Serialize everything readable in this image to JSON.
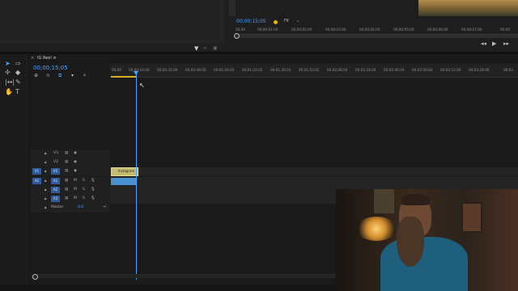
{
  "program": {
    "timecode": "00;00;15;05",
    "fit": "Fit",
    "ruler_ticks": [
      "00;00",
      "00;00;01;00",
      "00;00;02;00",
      "00;00;03;00",
      "00;00;04;00",
      "00;00;05;00",
      "00;00;06;00",
      "00;00;07;00",
      "00;00"
    ],
    "controls": [
      "step-back-icon",
      "play-icon",
      "step-forward-icon"
    ]
  },
  "tools": [
    "selection-tool",
    "track-select-tool",
    "ripple-edit-tool",
    "razor-tool",
    "slip-tool",
    "pen-tool",
    "hand-tool",
    "type-tool"
  ],
  "timeline": {
    "title": "IG Reel",
    "timecode": "00;00;15;05",
    "ruler_ticks": [
      "00;00",
      "00;00;16;00",
      "00;00;32;00",
      "00;00;48;00",
      "00;01;04;02",
      "00;01;20;02",
      "00;01;36;02",
      "00;01;52;02",
      "00;02;08;04",
      "00;02;24;04",
      "00;02;40;04",
      "00;02;56;04",
      "00;03;12;06",
      "00;03;28;06",
      "00;03"
    ],
    "video_tracks": [
      {
        "label": "V3"
      },
      {
        "label": "V2"
      },
      {
        "label": "V1",
        "source": "V1"
      }
    ],
    "audio_tracks": [
      {
        "label": "A1",
        "source": "A1",
        "m": "M",
        "s": "S"
      },
      {
        "label": "A2",
        "m": "M",
        "s": "S"
      },
      {
        "label": "A3",
        "m": "M",
        "s": "S"
      }
    ],
    "master": {
      "label": "Master",
      "value": "0.0"
    },
    "clip_name": "Instagram"
  },
  "colors": {
    "accent": "#4aa3ff",
    "clip_video": "#c5bb6e",
    "clip_audio": "#4a8fd0",
    "workarea": "#d4b020"
  }
}
